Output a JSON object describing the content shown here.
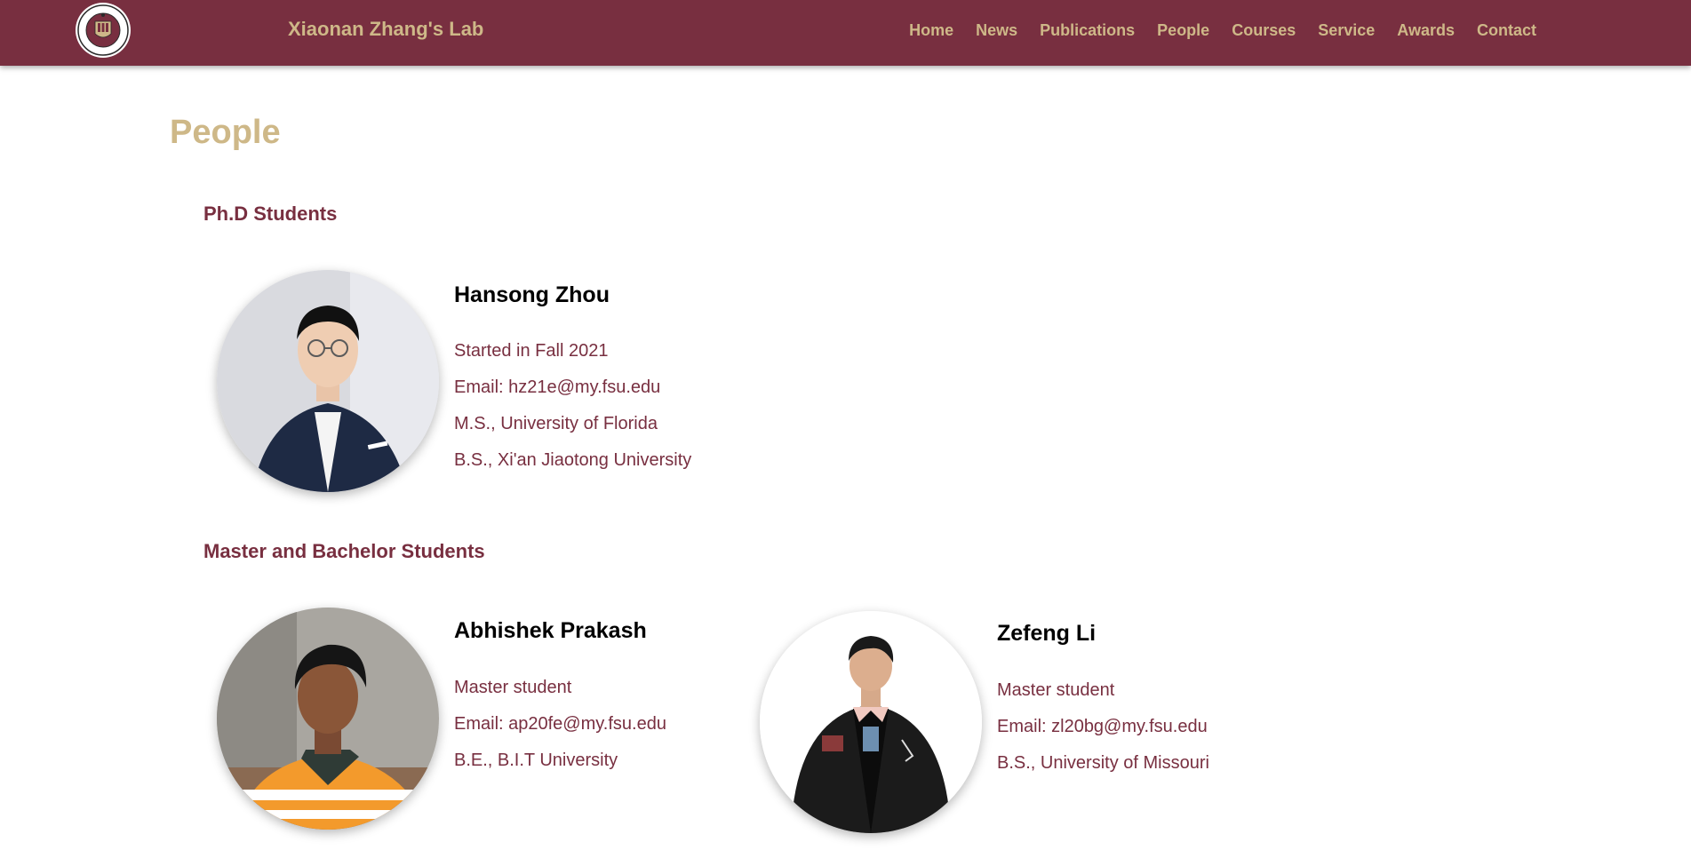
{
  "colors": {
    "garnet": "#782f40",
    "gold": "#ceb888",
    "text_dark": "#000000",
    "background": "#ffffff"
  },
  "header": {
    "logo_icon": "fsu-seal-icon",
    "logo_text_top": "FLORIDA STATE UNIVERSITY",
    "logo_year": "1851",
    "brand": "Xiaonan Zhang's Lab",
    "nav": [
      {
        "label": "Home"
      },
      {
        "label": "News"
      },
      {
        "label": "Publications"
      },
      {
        "label": "People"
      },
      {
        "label": "Courses"
      },
      {
        "label": "Service"
      },
      {
        "label": "Awards"
      },
      {
        "label": "Contact"
      }
    ]
  },
  "main": {
    "title": "People",
    "sections": [
      {
        "heading": "Ph.D Students",
        "people": [
          {
            "name": "Hansong Zhou",
            "photo_icon": "portrait-photo",
            "lines": [
              "Started in Fall 2021",
              "Email: hz21e@my.fsu.edu",
              "M.S., University of Florida",
              "B.S., Xi'an Jiaotong University"
            ]
          }
        ]
      },
      {
        "heading": "Master and Bachelor Students",
        "people": [
          {
            "name": "Abhishek Prakash",
            "photo_icon": "portrait-photo",
            "lines": [
              "Master student",
              "Email: ap20fe@my.fsu.edu",
              "B.E., B.I.T University"
            ]
          },
          {
            "name": "Zefeng Li",
            "photo_icon": "portrait-photo",
            "lines": [
              "Master student",
              "Email: zl20bg@my.fsu.edu",
              "B.S., University of Missouri"
            ]
          }
        ]
      }
    ]
  }
}
